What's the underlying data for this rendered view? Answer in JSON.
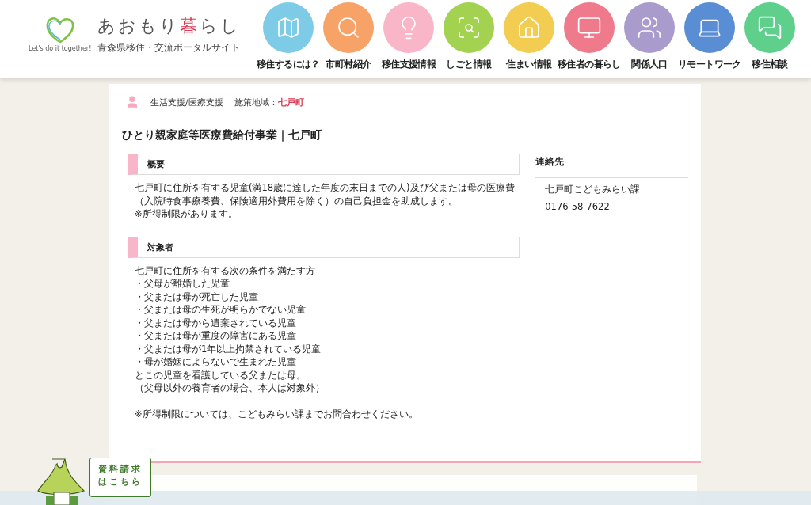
{
  "logo": {
    "slogan": "Let's do it together!",
    "title_before": "あおもり",
    "title_accent": "暮",
    "title_after": "らし",
    "subtitle": "青森県移住・交流ポータルサイト"
  },
  "nav": [
    {
      "label": "移住するには？",
      "color": "#7ecbe8",
      "kind": "map"
    },
    {
      "label": "市町村紹介",
      "color": "#f7a266",
      "kind": "search"
    },
    {
      "label": "移住支援情報",
      "color": "#f9b6c8",
      "kind": "idea"
    },
    {
      "label": "しごと情報",
      "color": "#a3d150",
      "kind": "job"
    },
    {
      "label": "住まい情報",
      "color": "#f3cc52",
      "kind": "house"
    },
    {
      "label": "移住者の暮らし",
      "color": "#ee7a8c",
      "kind": "video"
    },
    {
      "label": "関係人口",
      "color": "#a99ccc",
      "kind": "people"
    },
    {
      "label": "リモートワーク",
      "color": "#5a8ed4",
      "kind": "laptop"
    },
    {
      "label": "移住相談",
      "color": "#5fcf8c",
      "kind": "talk"
    }
  ],
  "article": {
    "category": "生活支援/医療支援",
    "area_label": "施策地域：",
    "area_value": "七戸町",
    "title": "ひとり親家庭等医療費給付事業｜七戸町",
    "sections": [
      {
        "heading": "概要",
        "lines": [
          "七戸町に住所を有する児童(満18歳に達した年度の末日までの人)及び父または母の医療費（入院時食事療養費、保険適用外費用を除く）の自己負担金を助成します。",
          "※所得制限があります。"
        ]
      },
      {
        "heading": "対象者",
        "lines": [
          "七戸町に住所を有する次の条件を満たす方",
          "・父母が離婚した児童",
          "・父または母が死亡した児童",
          "・父または母の生死が明らかでない児童",
          "・父または母から遺棄されている児童",
          "・父または母が重度の障害にある児童",
          "・父または母が1年以上拘禁されている児童",
          "・母が婚姻によらないで生まれた児童",
          "とこの児童を看護している父または母。",
          "（父母以外の養育者の場合、本人は対象外）"
        ],
        "note": "※所得制限については、こどもみらい課までお問合わせください。"
      }
    ],
    "contact": {
      "heading": "連絡先",
      "lines": [
        "七戸町こどもみらい課",
        "0176-58-7622"
      ]
    }
  },
  "request_button": {
    "label": "資料請求はこちら"
  }
}
